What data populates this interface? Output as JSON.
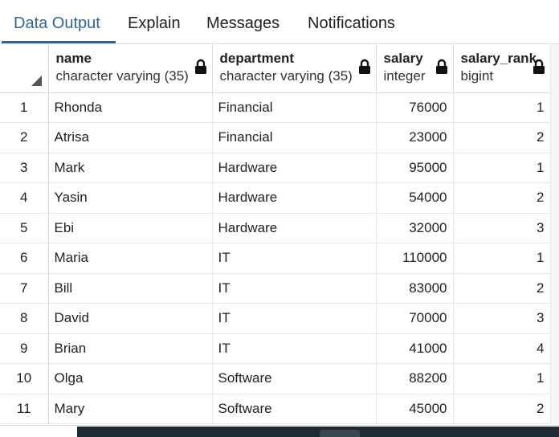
{
  "tabs": [
    {
      "label": "Data Output",
      "active": true
    },
    {
      "label": "Explain",
      "active": false
    },
    {
      "label": "Messages",
      "active": false
    },
    {
      "label": "Notifications",
      "active": false
    }
  ],
  "columns": [
    {
      "name": "name",
      "type": "character varying (35)",
      "locked": true
    },
    {
      "name": "department",
      "type": "character varying (35)",
      "locked": true
    },
    {
      "name": "salary",
      "type": "integer",
      "locked": true
    },
    {
      "name": "salary_rank",
      "type": "bigint",
      "locked": true
    }
  ],
  "rows": [
    {
      "n": "1",
      "name": "Rhonda",
      "department": "Financial",
      "salary": "76000",
      "salary_rank": "1"
    },
    {
      "n": "2",
      "name": "Atrisa",
      "department": "Financial",
      "salary": "23000",
      "salary_rank": "2"
    },
    {
      "n": "3",
      "name": "Mark",
      "department": "Hardware",
      "salary": "95000",
      "salary_rank": "1"
    },
    {
      "n": "4",
      "name": "Yasin",
      "department": "Hardware",
      "salary": "54000",
      "salary_rank": "2"
    },
    {
      "n": "5",
      "name": "Ebi",
      "department": "Hardware",
      "salary": "32000",
      "salary_rank": "3"
    },
    {
      "n": "6",
      "name": "Maria",
      "department": "IT",
      "salary": "110000",
      "salary_rank": "1"
    },
    {
      "n": "7",
      "name": "Bill",
      "department": "IT",
      "salary": "83000",
      "salary_rank": "2"
    },
    {
      "n": "8",
      "name": "David",
      "department": "IT",
      "salary": "70000",
      "salary_rank": "3"
    },
    {
      "n": "9",
      "name": "Brian",
      "department": "IT",
      "salary": "41000",
      "salary_rank": "4"
    },
    {
      "n": "10",
      "name": "Olga",
      "department": "Software",
      "salary": "88200",
      "salary_rank": "1"
    },
    {
      "n": "11",
      "name": "Mary",
      "department": "Software",
      "salary": "45000",
      "salary_rank": "2"
    }
  ],
  "colors": {
    "accent": "#326690",
    "border": "#d6dde3",
    "dark_bar": "#1f2a33"
  }
}
